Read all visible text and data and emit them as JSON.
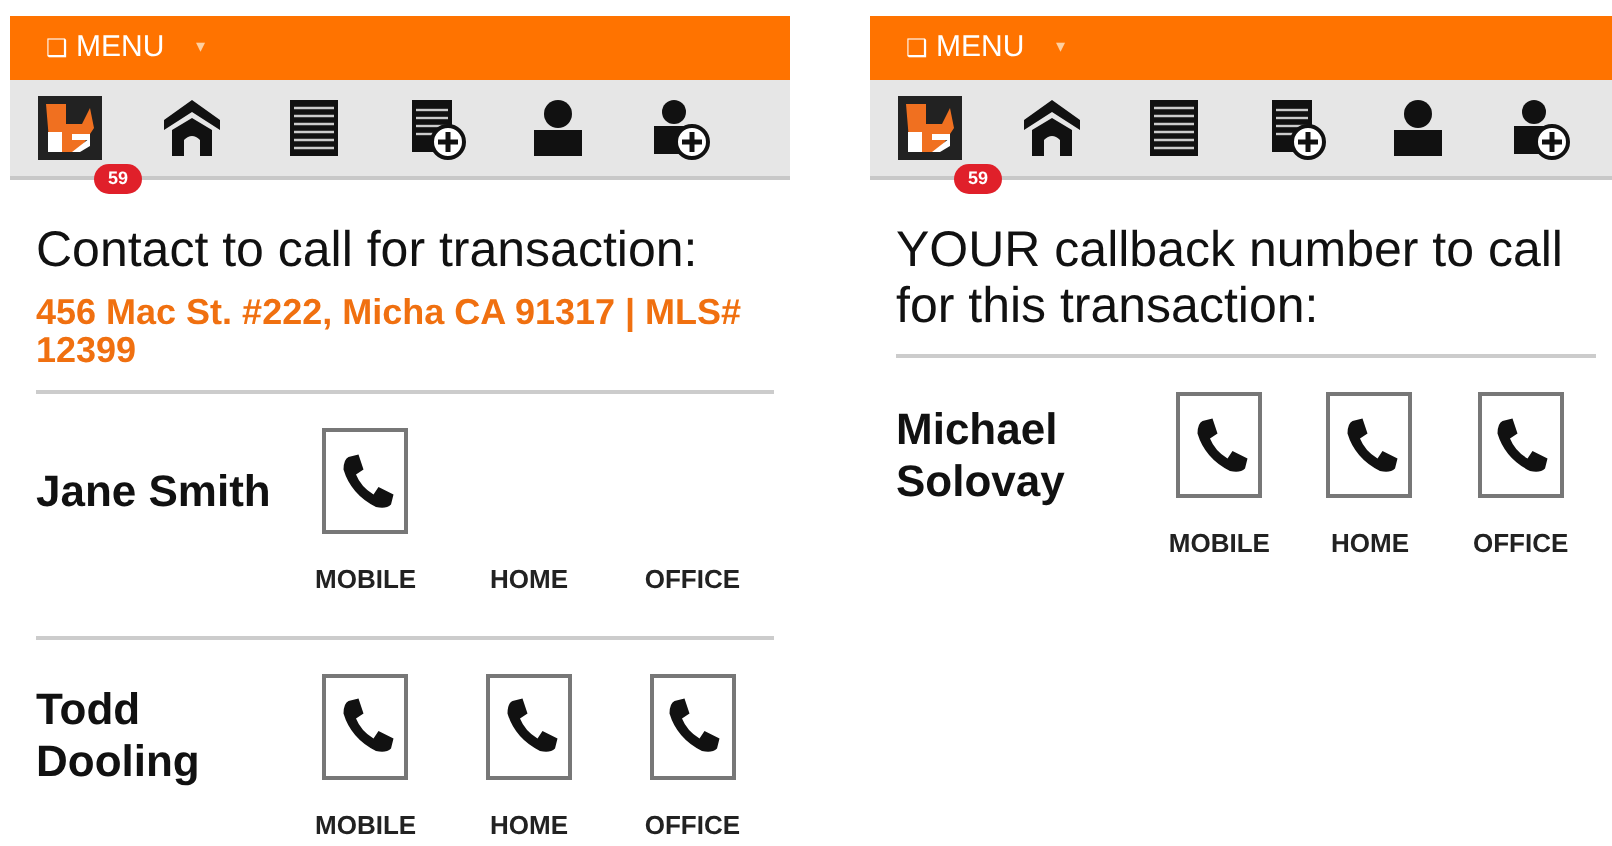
{
  "screens": [
    {
      "menu": {
        "icon": "❑",
        "label": "MENU",
        "caret": "▾"
      },
      "badge": "59",
      "heading": "Contact to call for transaction:",
      "subheading": "456 Mac St. #222, Micha CA 91317 | MLS# 12399",
      "contacts": [
        {
          "name": "Jane Smith",
          "phones": [
            {
              "label": "MOBILE",
              "available": true
            },
            {
              "label": "HOME",
              "available": false
            },
            {
              "label": "OFFICE",
              "available": false
            }
          ]
        },
        {
          "name": "Todd Dooling",
          "phones": [
            {
              "label": "MOBILE",
              "available": true
            },
            {
              "label": "HOME",
              "available": true
            },
            {
              "label": "OFFICE",
              "available": true
            }
          ]
        }
      ]
    },
    {
      "menu": {
        "icon": "❑",
        "label": "MENU",
        "caret": "▾"
      },
      "badge": "59",
      "heading": "YOUR callback number to call for this transaction:",
      "contacts": [
        {
          "name": "Michael Solovay",
          "phones": [
            {
              "label": "MOBILE",
              "available": true
            },
            {
              "label": "HOME",
              "available": true
            },
            {
              "label": "OFFICE",
              "available": true
            }
          ]
        }
      ]
    }
  ]
}
